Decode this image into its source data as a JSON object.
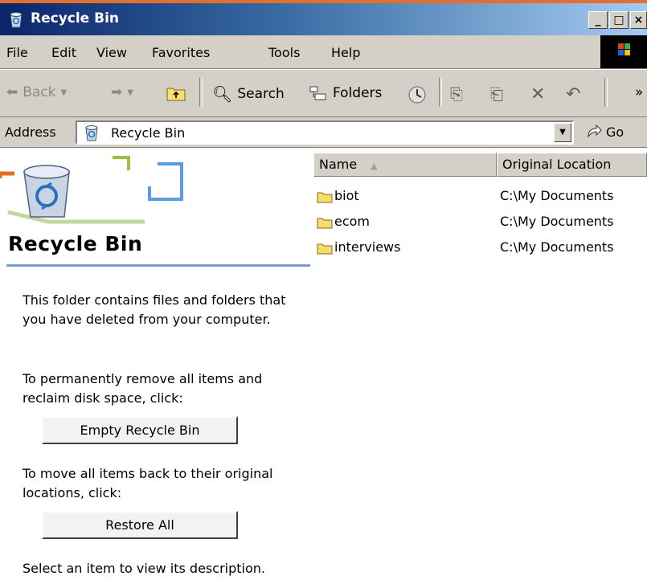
{
  "window": {
    "title": "Recycle Bin",
    "minimize": "_",
    "maximize": "□",
    "close": "×"
  },
  "menu": [
    "File",
    "Edit",
    "View",
    "Favorites",
    "Tools",
    "Help"
  ],
  "toolbar": {
    "back": "Back",
    "search": "Search",
    "folders": "Folders",
    "more": "»"
  },
  "address": {
    "label": "Address",
    "value": "Recycle Bin",
    "go": "Go"
  },
  "leftpane": {
    "title": "Recycle Bin",
    "intro": "This folder contains files and folders that you have deleted from your computer.",
    "empty_prompt": "To permanently remove all items and reclaim disk space, click:",
    "empty_button": "Empty Recycle Bin",
    "restore_prompt": "To move all items back to their original locations, click:",
    "restore_button": "Restore All",
    "hint": "Select an item to view its description."
  },
  "list": {
    "columns": [
      "Name",
      "Original Location"
    ],
    "sort_indicator": "▲",
    "rows": [
      {
        "name": "biot",
        "location": "C:\\My Documents"
      },
      {
        "name": "ecom",
        "location": "C:\\My Documents"
      },
      {
        "name": "interviews",
        "location": "C:\\My Documents"
      }
    ]
  },
  "colors": {
    "title_start": "#0a246a",
    "title_end": "#a6caf0",
    "chrome": "#d4d0c8",
    "accent_line": "#7a9ccc"
  }
}
